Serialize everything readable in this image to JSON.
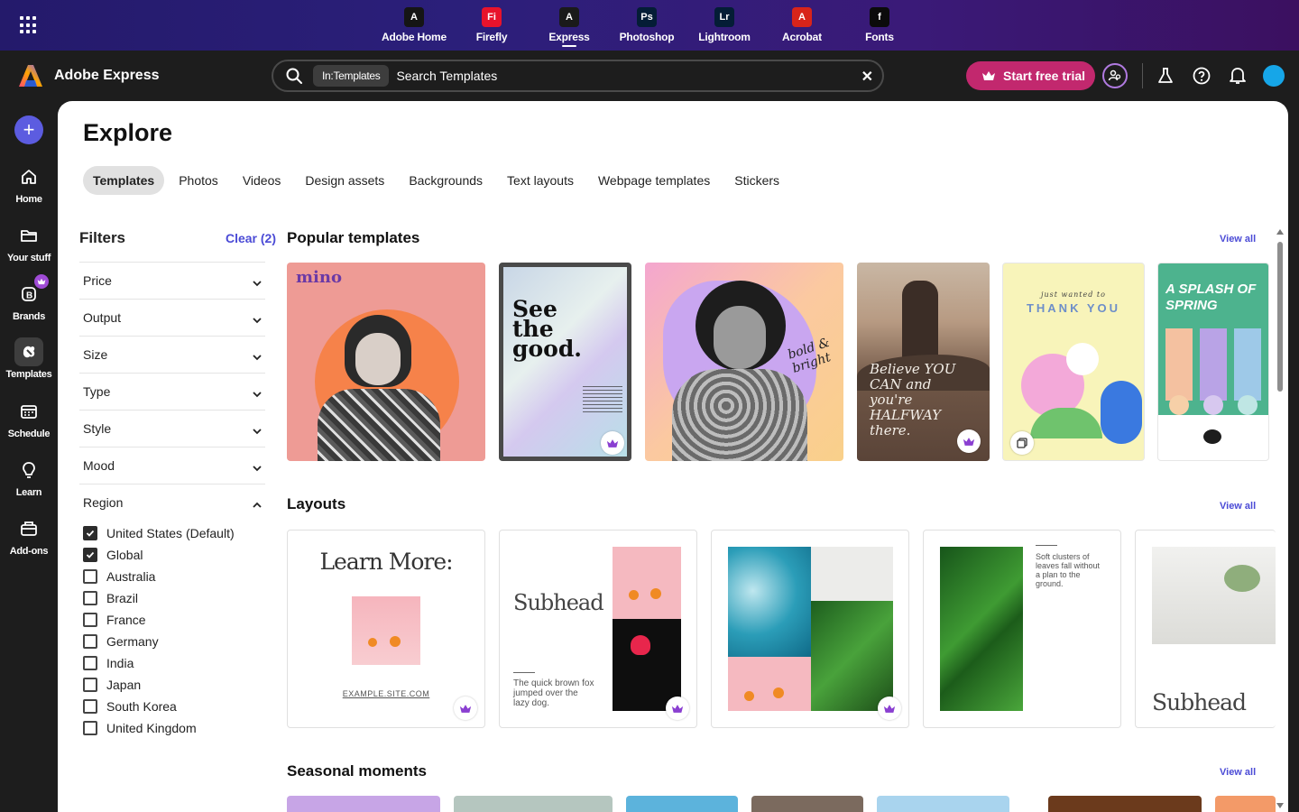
{
  "app_switcher": {
    "apps": [
      {
        "label": "Adobe Home",
        "mark": "A",
        "color": "#151515"
      },
      {
        "label": "Firefly",
        "mark": "Fi",
        "color": "#e8132b"
      },
      {
        "label": "Express",
        "mark": "A",
        "color": "#1a1a1a"
      },
      {
        "label": "Photoshop",
        "mark": "Ps",
        "color": "#041d36"
      },
      {
        "label": "Lightroom",
        "mark": "Lr",
        "color": "#041d36"
      },
      {
        "label": "Acrobat",
        "mark": "A",
        "color": "#d8241a"
      },
      {
        "label": "Fonts",
        "mark": "f",
        "color": "#0b0b0b"
      }
    ],
    "active": "Express"
  },
  "header": {
    "brand": "Adobe Express",
    "search_chip": "In:Templates",
    "search_text": "Search Templates",
    "trial_label": "Start free trial"
  },
  "rail": {
    "items": [
      {
        "label": "Home",
        "icon": "home-icon"
      },
      {
        "label": "Your stuff",
        "icon": "folder-icon"
      },
      {
        "label": "Brands",
        "icon": "brand-icon"
      },
      {
        "label": "Templates",
        "icon": "templates-icon"
      },
      {
        "label": "Schedule",
        "icon": "calendar-icon"
      },
      {
        "label": "Learn",
        "icon": "lightbulb-icon"
      },
      {
        "label": "Add-ons",
        "icon": "addons-icon"
      }
    ],
    "active": "Templates"
  },
  "main": {
    "title": "Explore",
    "tabs": [
      "Templates",
      "Photos",
      "Videos",
      "Design assets",
      "Backgrounds",
      "Text layouts",
      "Webpage templates",
      "Stickers"
    ],
    "active_tab": "Templates"
  },
  "filters": {
    "title": "Filters",
    "clear": "Clear (2)",
    "groups": [
      "Price",
      "Output",
      "Size",
      "Type",
      "Style",
      "Mood"
    ],
    "region_label": "Region",
    "regions": [
      {
        "label": "United States (Default)",
        "checked": true
      },
      {
        "label": "Global",
        "checked": true
      },
      {
        "label": "Australia",
        "checked": false
      },
      {
        "label": "Brazil",
        "checked": false
      },
      {
        "label": "France",
        "checked": false
      },
      {
        "label": "Germany",
        "checked": false
      },
      {
        "label": "India",
        "checked": false
      },
      {
        "label": "Japan",
        "checked": false
      },
      {
        "label": "South Korea",
        "checked": false
      },
      {
        "label": "United Kingdom",
        "checked": false
      }
    ]
  },
  "sections": {
    "popular": {
      "title": "Popular templates",
      "view_all": "View all",
      "cards": {
        "mino": "mino",
        "see_good": "See the good.",
        "bold": "bold & bright",
        "believe": "Believe YOU CAN and you're HALFWAY there.",
        "thank_pre": "just wanted to",
        "thank": "THANK YOU",
        "splash": "A SPLASH OF SPRING"
      }
    },
    "layouts": {
      "title": "Layouts",
      "view_all": "View all",
      "cards": {
        "learn_more": "Learn More:",
        "site": "EXAMPLE.SITE.COM",
        "subhead": "Subhead",
        "fox": "The quick brown fox jumped over the lazy dog.",
        "clusters": "Soft clusters of leaves fall without a plan to the ground.",
        "subhead2": "Subhead"
      }
    },
    "seasonal": {
      "title": "Seasonal moments",
      "view_all": "View all"
    }
  }
}
